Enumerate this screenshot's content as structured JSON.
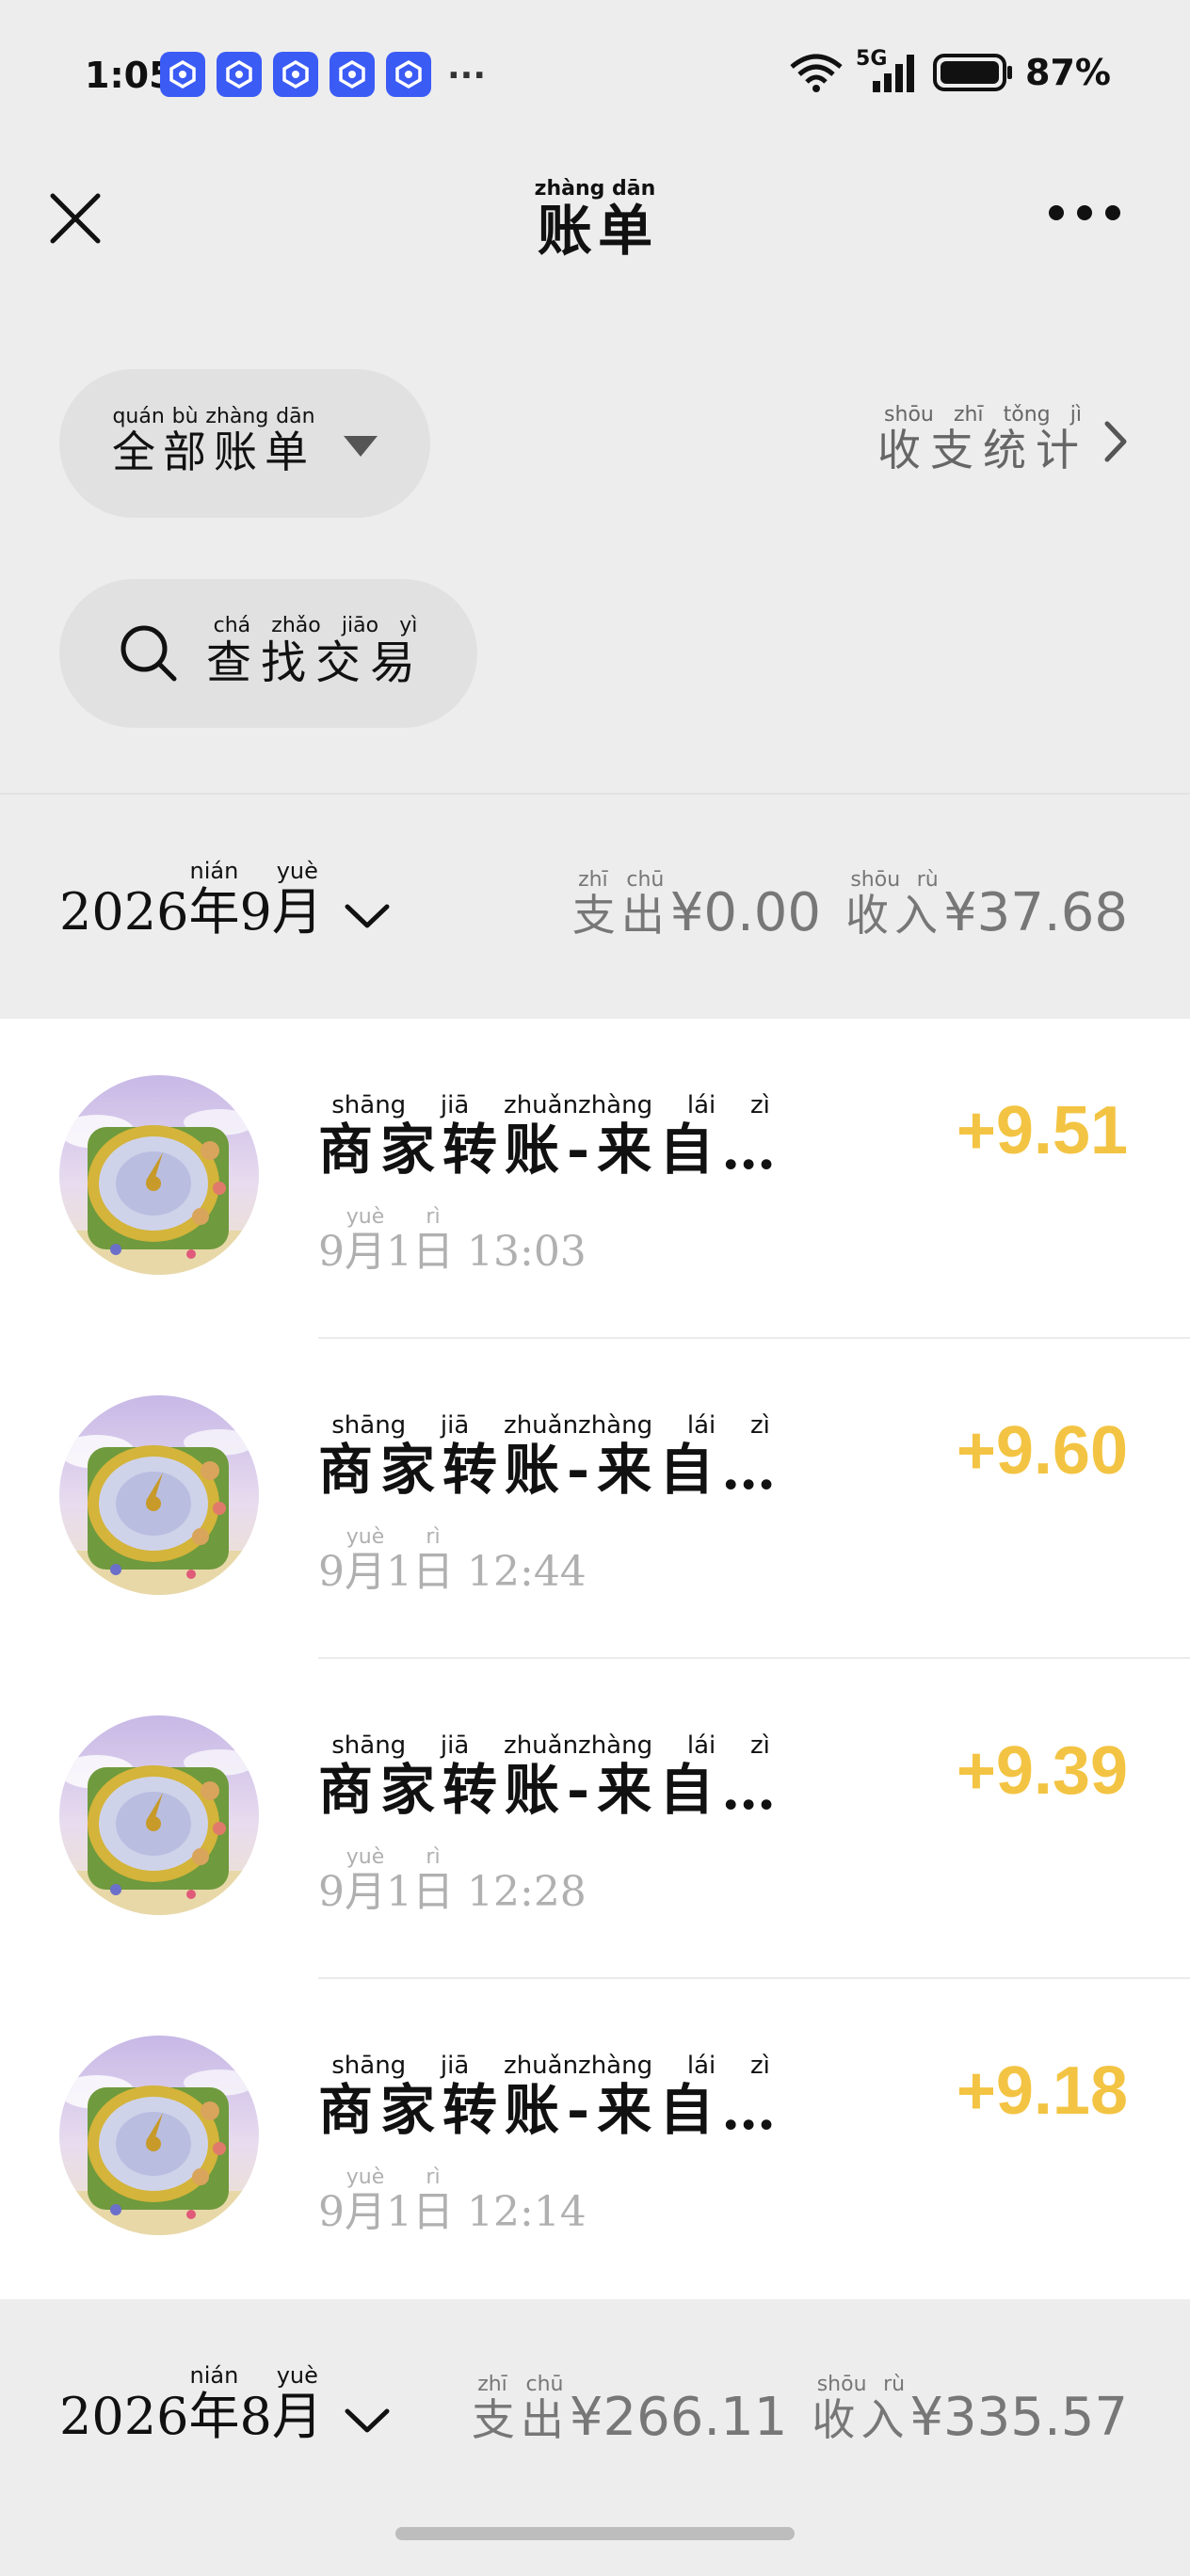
{
  "status_bar": {
    "time": "1:05",
    "notification_more": "···",
    "network": "5G",
    "battery": "87%"
  },
  "header": {
    "title": "账单",
    "title_pinyin": "zhàng dān"
  },
  "filter": {
    "label": "全部账单",
    "pinyin": "quán bù zhàng dān"
  },
  "stats": {
    "label": "收支统计",
    "pinyin": "shōu zhī tǒng jì"
  },
  "search": {
    "label": "查找交易",
    "pinyin": "chá zhǎo jiāo yì"
  },
  "months": [
    {
      "year": "2026",
      "nian": "年",
      "nian_pinyin": "nián",
      "month": "9",
      "yue": "月",
      "yue_pinyin": "yuè",
      "expense_label": "支出",
      "expense_pinyin": "zhī chū",
      "expense": "¥0.00",
      "income_label": "收入",
      "income_pinyin": "shōu rù",
      "income": "¥37.68"
    },
    {
      "year": "2026",
      "nian": "年",
      "nian_pinyin": "nián",
      "month": "8",
      "yue": "月",
      "yue_pinyin": "yuè",
      "expense_label": "支出",
      "expense_pinyin": "zhī chū",
      "expense": "¥266.11",
      "income_label": "收入",
      "income_pinyin": "shōu rù",
      "income": "¥335.57"
    }
  ],
  "transactions": [
    {
      "title": "商家转账-来自…",
      "title_pinyin": "shāng jiā zhuǎnzhàng lái zì",
      "month": "9",
      "yue": "月",
      "yue_pinyin": "yuè",
      "day": "1",
      "ri": "日",
      "ri_pinyin": "rì",
      "time": "13:03",
      "amount": "+9.51"
    },
    {
      "title": "商家转账-来自…",
      "title_pinyin": "shāng jiā zhuǎnzhàng lái zì",
      "month": "9",
      "yue": "月",
      "yue_pinyin": "yuè",
      "day": "1",
      "ri": "日",
      "ri_pinyin": "rì",
      "time": "12:44",
      "amount": "+9.60"
    },
    {
      "title": "商家转账-来自…",
      "title_pinyin": "shāng jiā zhuǎnzhàng lái zì",
      "month": "9",
      "yue": "月",
      "yue_pinyin": "yuè",
      "day": "1",
      "ri": "日",
      "ri_pinyin": "rì",
      "time": "12:28",
      "amount": "+9.39"
    },
    {
      "title": "商家转账-来自…",
      "title_pinyin": "shāng jiā zhuǎnzhàng lái zì",
      "month": "9",
      "yue": "月",
      "yue_pinyin": "yuè",
      "day": "1",
      "ri": "日",
      "ri_pinyin": "rì",
      "time": "12:14",
      "amount": "+9.18"
    }
  ],
  "colors": {
    "income": "#f3c443",
    "background": "#ededed",
    "app_icon": "#3b5bf5"
  }
}
